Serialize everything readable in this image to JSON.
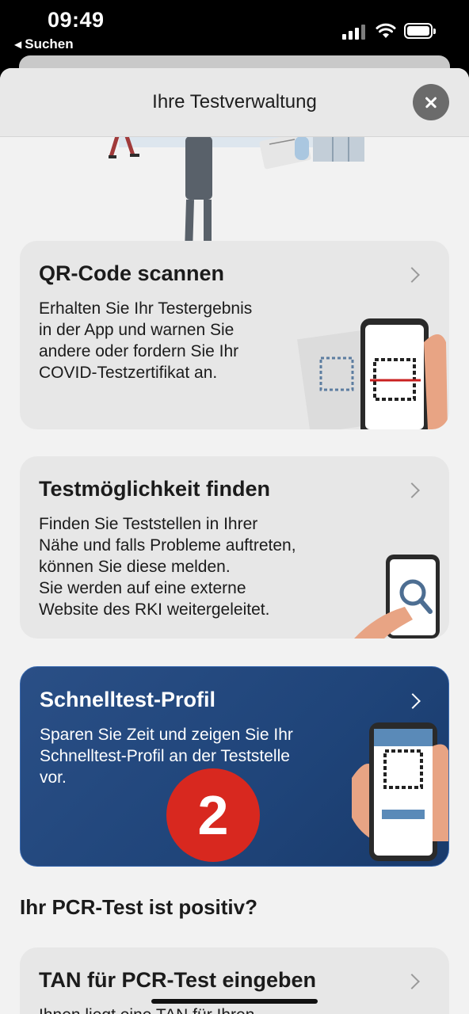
{
  "status_bar": {
    "time": "09:49",
    "back_label": "Suchen"
  },
  "nav": {
    "title": "Ihre Testverwaltung"
  },
  "cards": [
    {
      "title": "QR-Code scannen",
      "body": "Erhalten Sie Ihr Testergebnis\nin der App und warnen Sie\nandere oder fordern Sie Ihr\nCOVID-Testzertifikat an.",
      "illustration": "phone-qr-scan"
    },
    {
      "title": "Testmöglichkeit finden",
      "body": "Finden Sie Teststellen in Ihrer\nNähe und falls Probleme auftreten,\nkönnen Sie diese melden.\nSie werden auf eine externe\nWebsite des RKI weitergeleitet.",
      "illustration": "phone-magnifier"
    },
    {
      "title": "Schnelltest-Profil",
      "body": "Sparen Sie Zeit und zeigen Sie Ihr\nSchnelltest-Profil an der Teststelle\nvor.",
      "illustration": "phone-qr-profile"
    },
    {
      "title": "TAN für PCR-Test eingeben",
      "body": "Ihnen liegt eine TAN für Ihren"
    }
  ],
  "badge": {
    "number": "2"
  },
  "section": {
    "heading": "Ihr PCR-Test ist positiv?"
  },
  "colors": {
    "accent_blue": "#1f4479",
    "badge_red": "#d8281f",
    "sheet_bg": "#f2f2f2"
  },
  "icons": [
    "signal-icon",
    "wifi-icon",
    "battery-icon",
    "close-icon",
    "chevron-right-icon"
  ]
}
